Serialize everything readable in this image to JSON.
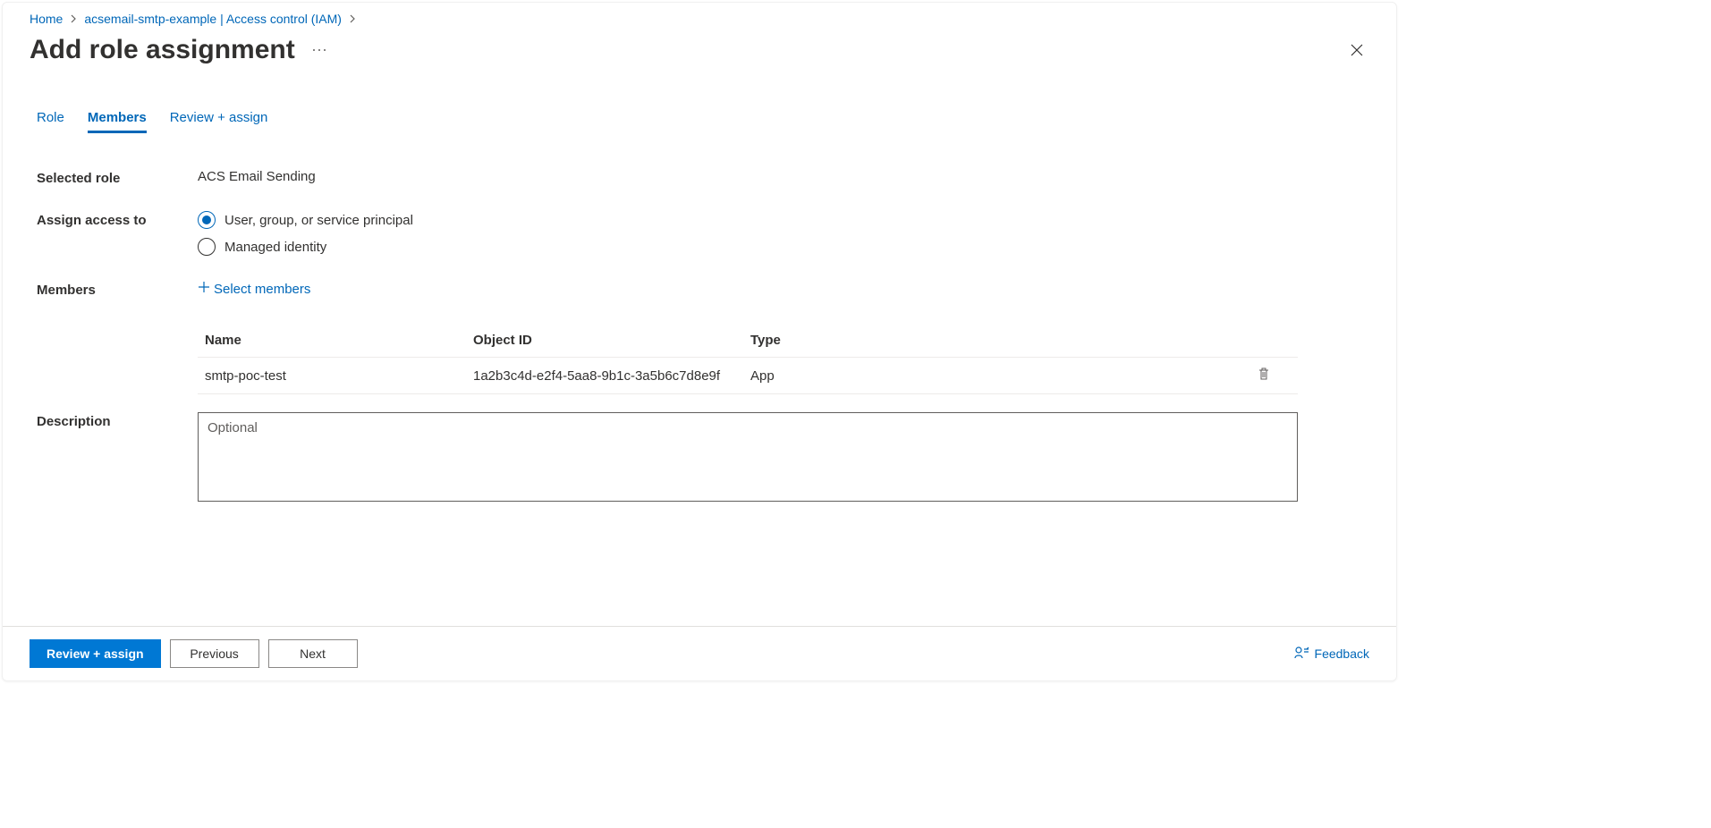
{
  "breadcrumb": {
    "items": [
      {
        "label": "Home"
      },
      {
        "label": "acsemail-smtp-example | Access control (IAM)"
      }
    ]
  },
  "page": {
    "title": "Add role assignment"
  },
  "tabs": [
    {
      "label": "Role",
      "active": false
    },
    {
      "label": "Members",
      "active": true
    },
    {
      "label": "Review + assign",
      "active": false
    }
  ],
  "form": {
    "selected_role_label": "Selected role",
    "selected_role_value": "ACS Email Sending",
    "assign_access_to_label": "Assign access to",
    "assign_access_options": [
      {
        "label": "User, group, or service principal",
        "checked": true
      },
      {
        "label": "Managed identity",
        "checked": false
      }
    ],
    "members_label": "Members",
    "select_members_link": "Select members",
    "members_table": {
      "headers": {
        "name": "Name",
        "object_id": "Object ID",
        "type": "Type"
      },
      "rows": [
        {
          "name": "smtp-poc-test",
          "object_id": "1a2b3c4d-e2f4-5aa8-9b1c-3a5b6c7d8e9f",
          "type": "App"
        }
      ]
    },
    "description_label": "Description",
    "description_placeholder": "Optional"
  },
  "footer": {
    "review_assign_label": "Review + assign",
    "previous_label": "Previous",
    "next_label": "Next",
    "feedback_label": "Feedback"
  }
}
